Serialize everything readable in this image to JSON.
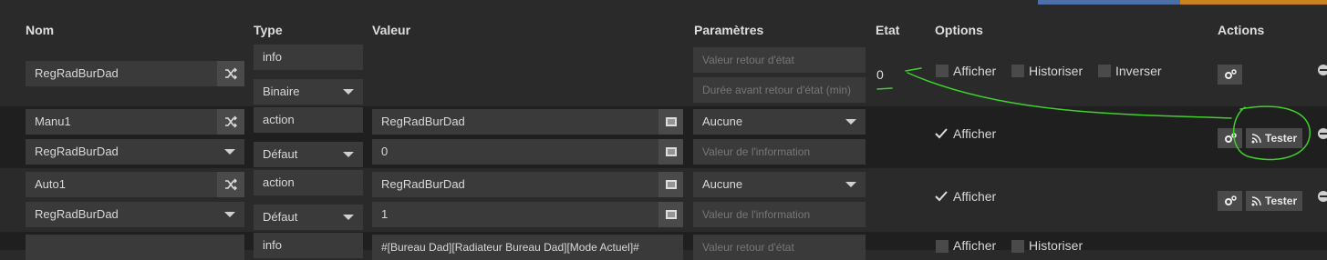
{
  "headers": {
    "nom": "Nom",
    "type": "Type",
    "valeur": "Valeur",
    "parametres": "Paramètres",
    "etat": "Etat",
    "options": "Options",
    "actions": "Actions"
  },
  "rows": [
    {
      "nom": "RegRadBurDad",
      "type_top": "info",
      "type_bottom": "Binaire",
      "param_top_placeholder": "Valeur retour d'état",
      "param_bottom_placeholder": "Durée avant retour d'état (min)",
      "etat": "0",
      "options": {
        "afficher": "Afficher",
        "historiser": "Historiser",
        "inverser": "Inverser"
      }
    },
    {
      "nom": "Manu1",
      "nom_select": "RegRadBurDad",
      "type_top": "action",
      "type_bottom": "Défaut",
      "valeur_top": "RegRadBurDad",
      "valeur_bottom": "0",
      "param_select": "Aucune",
      "param_bottom_placeholder": "Valeur de l'information",
      "options": {
        "afficher": "Afficher"
      },
      "tester_label": "Tester"
    },
    {
      "nom": "Auto1",
      "nom_select": "RegRadBurDad",
      "type_top": "action",
      "type_bottom": "Défaut",
      "valeur_top": "RegRadBurDad",
      "valeur_bottom": "1",
      "param_select": "Aucune",
      "param_bottom_placeholder": "Valeur de l'information",
      "options": {
        "afficher": "Afficher"
      },
      "tester_label": "Tester"
    },
    {
      "type_top": "info",
      "valeur_top": "#[Bureau Dad][Radiateur Bureau Dad][Mode Actuel]#",
      "param_top_placeholder": "Valeur retour d'état",
      "options": {
        "afficher": "Afficher",
        "historiser": "Historiser"
      }
    }
  ],
  "colors": {
    "annotation": "#3fd12b",
    "field_bg": "#3a3a3a",
    "alt_row_bg": "#1f1f1f"
  },
  "icons": [
    "cogs-icon",
    "list-icon",
    "rss-icon",
    "shuffle-icon",
    "check-icon",
    "minus-circle-icon"
  ]
}
